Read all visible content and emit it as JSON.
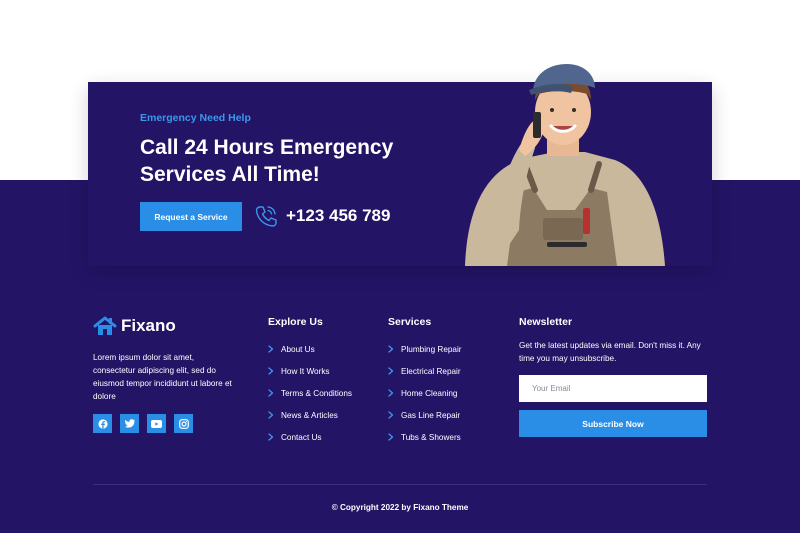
{
  "colors": {
    "navy": "#241466",
    "accent": "#2b8ee6",
    "white": "#ffffff"
  },
  "cta": {
    "eyebrow": "Emergency Need Help",
    "title_line1": "Call 24 Hours Emergency",
    "title_line2": "Services All Time!",
    "button_label": "Request a Service",
    "phone_icon": "phone-icon",
    "phone": "+123 456 789",
    "image": "plumber-on-phone-photo"
  },
  "brand": {
    "name": "Fixano",
    "logo_icon": "house-logo-icon"
  },
  "about": {
    "text": "Lorem ipsum dolor sit amet, consectetur adipiscing elit, sed do eiusmod tempor incididunt ut labore et dolore"
  },
  "socials": [
    {
      "icon": "facebook-icon"
    },
    {
      "icon": "twitter-icon"
    },
    {
      "icon": "youtube-icon"
    },
    {
      "icon": "instagram-icon"
    }
  ],
  "explore": {
    "title": "Explore Us",
    "items": [
      "About Us",
      "How It Works",
      "Terms & Conditions",
      "News & Articles",
      "Contact Us"
    ]
  },
  "services": {
    "title": "Services",
    "items": [
      "Plumbing Repair",
      "Electrical Repair",
      "Home Cleaning",
      "Gas Line Repair",
      "Tubs & Showers"
    ]
  },
  "newsletter": {
    "title": "Newsletter",
    "description": "Get the latest updates via email. Don't miss it. Any time you may unsubscribe.",
    "email_placeholder": "Your Email",
    "button_label": "Subscribe Now"
  },
  "copyright": "© Copyright 2022 by Fixano Theme"
}
